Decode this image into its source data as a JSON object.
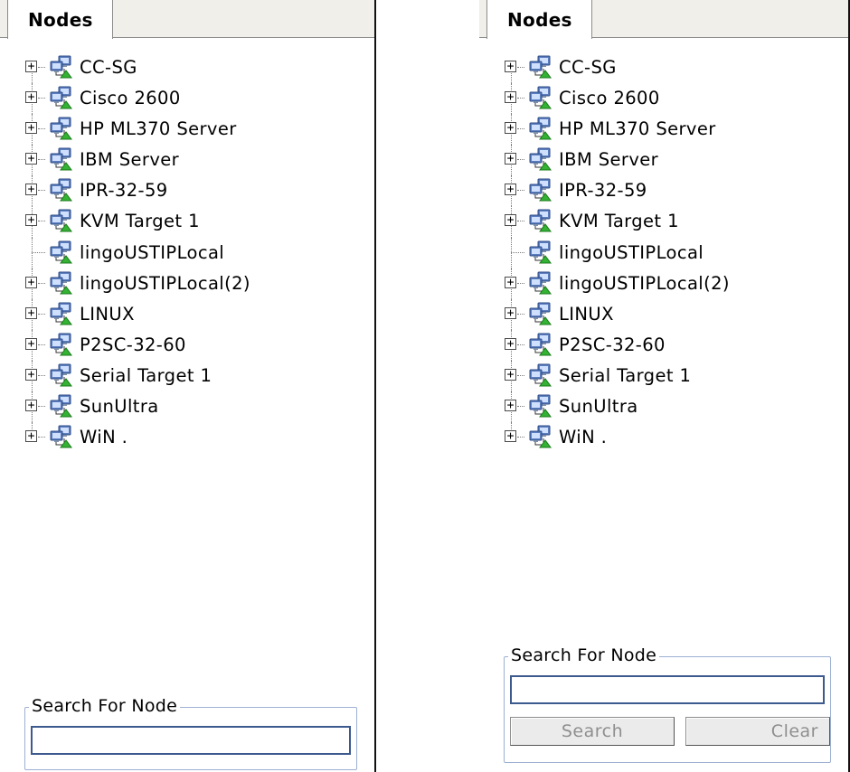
{
  "panels": [
    {
      "tab_label": "Nodes",
      "search": {
        "legend": "Search For Node",
        "value": "",
        "placeholder": "",
        "show_buttons": false
      }
    },
    {
      "tab_label": "Nodes",
      "search": {
        "legend": "Search For Node",
        "value": "",
        "placeholder": "",
        "show_buttons": true,
        "search_label": "Search",
        "clear_label": "Clear"
      }
    }
  ],
  "nodes": [
    {
      "label": "CC-SG",
      "expandable": true
    },
    {
      "label": "Cisco 2600",
      "expandable": true
    },
    {
      "label": "HP ML370 Server",
      "expandable": true
    },
    {
      "label": "IBM Server",
      "expandable": true
    },
    {
      "label": "IPR-32-59",
      "expandable": true
    },
    {
      "label": "KVM Target 1",
      "expandable": true
    },
    {
      "label": "lingoUSTIPLocal",
      "expandable": false
    },
    {
      "label": "lingoUSTIPLocal(2)",
      "expandable": true
    },
    {
      "label": "LINUX",
      "expandable": true
    },
    {
      "label": "P2SC-32-60",
      "expandable": true
    },
    {
      "label": "Serial Target 1",
      "expandable": true
    },
    {
      "label": "SunUltra",
      "expandable": true
    },
    {
      "label": "WiN .",
      "expandable": true
    }
  ],
  "icons": {
    "node": "computer-network-icon",
    "expander": "plus-box-icon"
  },
  "colors": {
    "tab_bar": "#f0efe9",
    "group_border": "#9db0d2",
    "input_border": "#3d5a8f",
    "disabled_text": "#8f8f8f"
  }
}
